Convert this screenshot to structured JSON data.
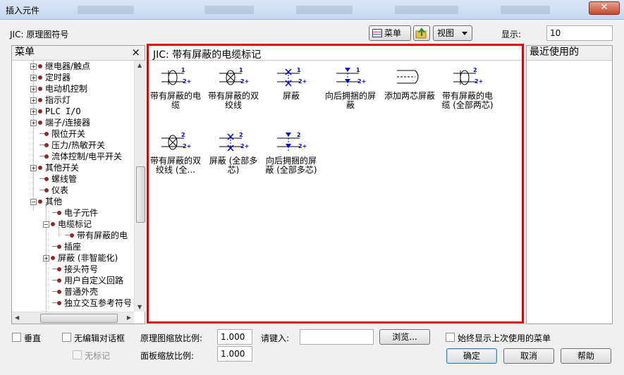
{
  "window": {
    "title": "插入元件"
  },
  "library_label": "JIC: 原理图符号",
  "toolbar": {
    "menu_button": "菜单",
    "view_button": "视图",
    "display_label": "显示:",
    "display_value": "10"
  },
  "menu_panel": {
    "header": "菜单",
    "close": "×",
    "items": [
      {
        "label": "继电器/触点"
      },
      {
        "label": "定时器"
      },
      {
        "label": "电动机控制"
      },
      {
        "label": "指示灯"
      },
      {
        "label": "PLC I/O"
      },
      {
        "label": "端子/连接器"
      },
      {
        "label": "限位开关"
      },
      {
        "label": "压力/热敏开关"
      },
      {
        "label": "流体控制/电平开关"
      },
      {
        "label": "其他开关"
      },
      {
        "label": "螺线管"
      },
      {
        "label": "仪表"
      },
      {
        "label": "其他"
      },
      {
        "label": "电子元件"
      },
      {
        "label": "电缆标记"
      },
      {
        "label": "带有屏蔽的电"
      },
      {
        "label": "插座"
      },
      {
        "label": "屏蔽 (非智能化)"
      },
      {
        "label": "接头符号"
      },
      {
        "label": "用户自定义回路"
      },
      {
        "label": "普通外壳"
      },
      {
        "label": "独立交互参考符号"
      }
    ]
  },
  "gallery": {
    "title": "JIC: 带有屏蔽的电缆标记",
    "symbols": [
      {
        "line1": "带有屏蔽的电",
        "line2": "缆"
      },
      {
        "line1": "带有屏蔽的双",
        "line2": "绞线"
      },
      {
        "line1": "屏蔽",
        "line2": ""
      },
      {
        "line1": "向后拥捆的屏",
        "line2": "蔽"
      },
      {
        "line1": "添加两芯屏蔽",
        "line2": ""
      },
      {
        "line1": "带有屏蔽的电",
        "line2": "缆 (全部两芯)"
      },
      {
        "line1": "带有屏蔽的双",
        "line2": "绞线 (全..."
      },
      {
        "line1": "屏蔽 (全部多",
        "line2": "芯)"
      },
      {
        "line1": "向后拥捆的屏",
        "line2": "蔽 (全部多芯)"
      }
    ],
    "tag1": "1",
    "tag2": "2+",
    "tag3": "2"
  },
  "recent_panel": {
    "header": "最近使用的"
  },
  "options": {
    "vertical": "垂直",
    "no_edit_dialog": "无编辑对话框",
    "no_mark": "无标记",
    "schematic_scale_label": "原理图缩放比例:",
    "schematic_scale_value": "1.000",
    "panel_scale_label": "面板缩放比例:",
    "panel_scale_value": "1.000",
    "type_label": "请键入:",
    "type_value": "",
    "browse": "浏览...",
    "always_show_last": "始终显示上次使用的菜单"
  },
  "buttons": {
    "ok": "确定",
    "cancel": "取消",
    "help": "帮助"
  },
  "colors": {
    "highlight_border": "#e00000",
    "symbol_blue": "#0000cc"
  }
}
